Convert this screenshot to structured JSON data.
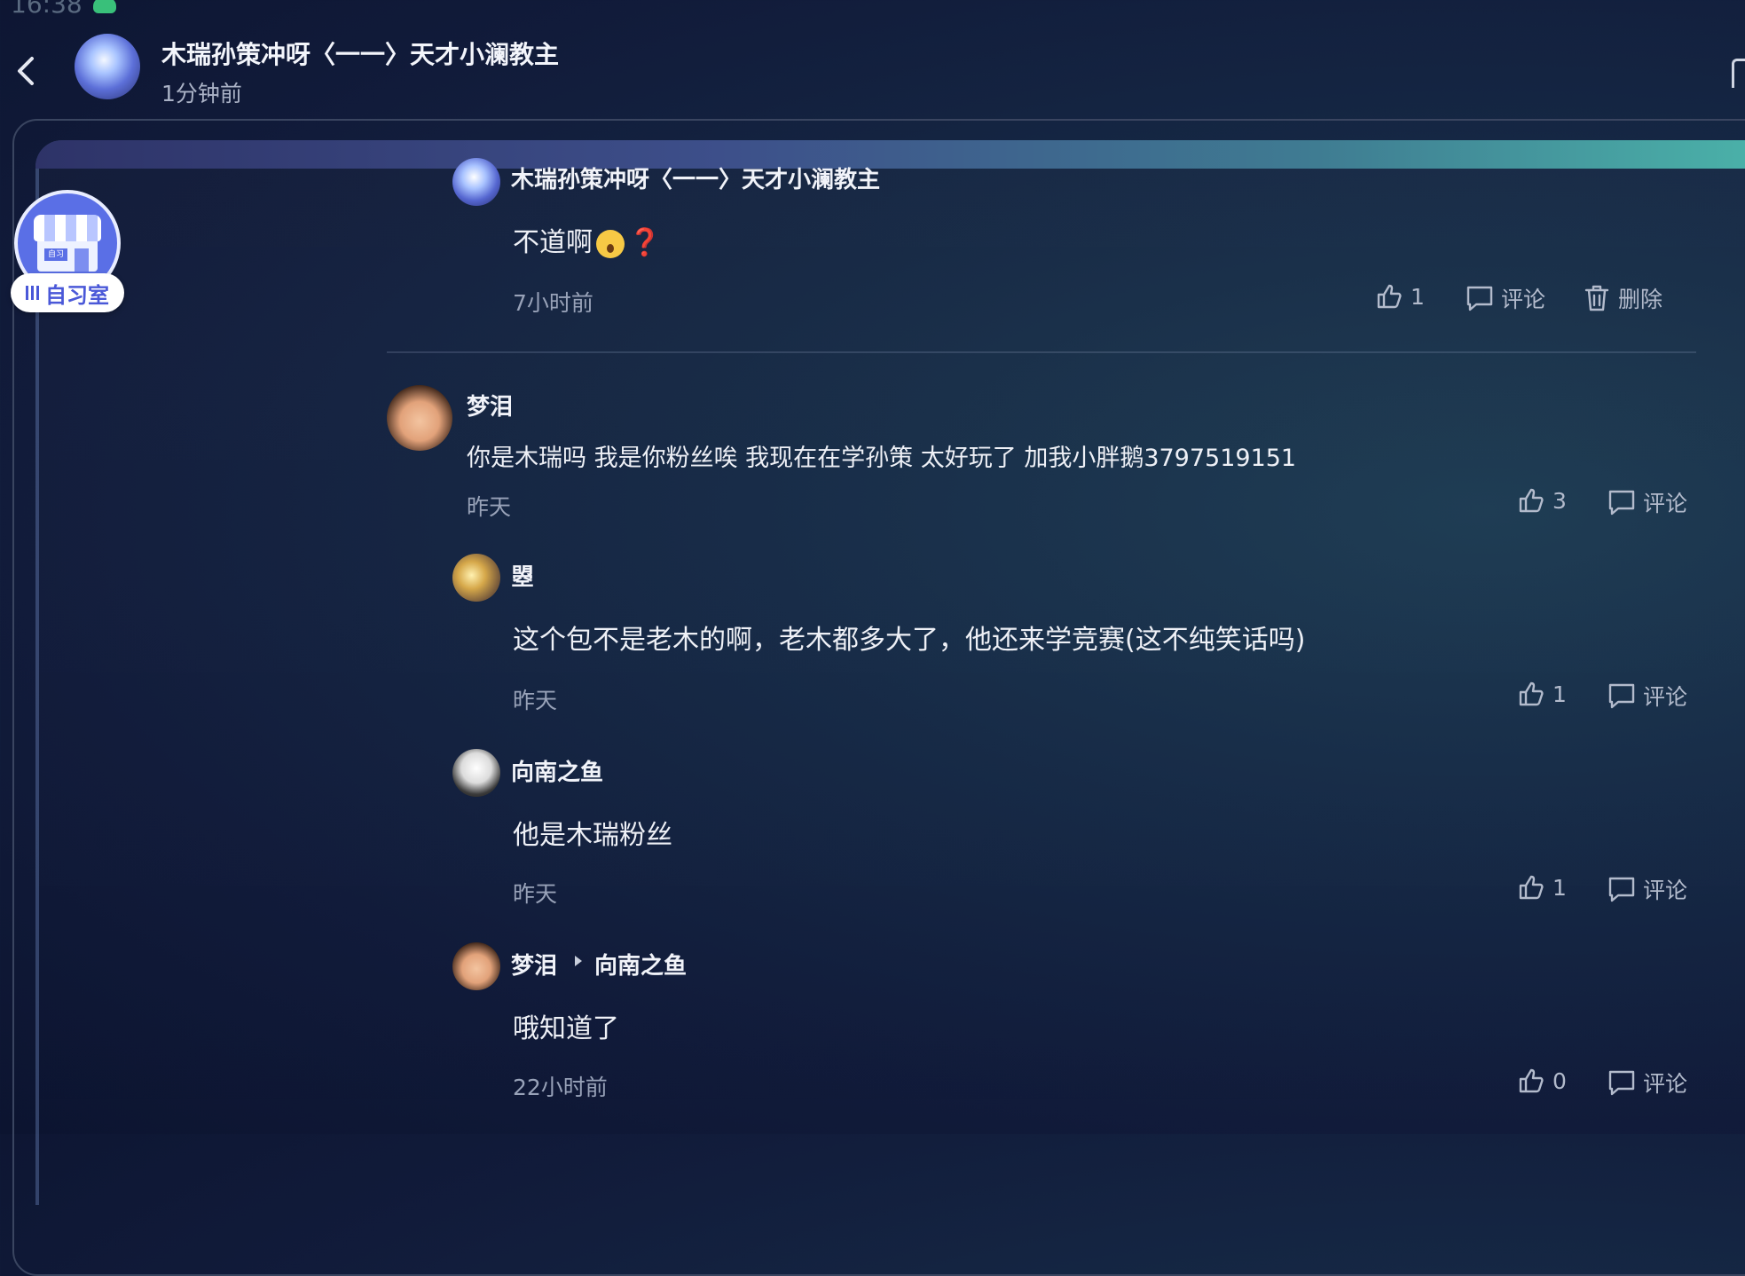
{
  "status": {
    "time": "16:38"
  },
  "header": {
    "title": "木瑞孙策冲呀〈一一〉天才小澜教主",
    "subtitle": "1分钟前"
  },
  "sidebar": {
    "study_room_label": "自习室"
  },
  "comments": [
    {
      "name": "木瑞孙策冲呀〈一一〉天才小澜教主",
      "text": "不道啊",
      "qmark": "❓",
      "time": "7小时前",
      "likes": "1",
      "comment_label": "评论",
      "delete_label": "删除"
    },
    {
      "name": "梦泪",
      "text": "你是木瑞吗 我是你粉丝唉 我现在在学孙策 太好玩了 加我小胖鹅3797519151",
      "time": "昨天",
      "likes": "3",
      "comment_label": "评论"
    },
    {
      "name": "曌",
      "text": "这个包不是老木的啊，老木都多大了，他还来学竞赛(这不纯笑话吗)",
      "time": "昨天",
      "likes": "1",
      "comment_label": "评论"
    },
    {
      "name": "向南之鱼",
      "text": "他是木瑞粉丝",
      "time": "昨天",
      "likes": "1",
      "comment_label": "评论"
    },
    {
      "name": "梦泪",
      "reply_to": "向南之鱼",
      "text": "哦知道了",
      "time": "22小时前",
      "likes": "0",
      "comment_label": "评论"
    }
  ],
  "icons": {
    "back": "chevron-left-icon",
    "like": "thumbs-up-icon",
    "comment": "comment-bubble-icon",
    "delete": "trash-icon"
  }
}
